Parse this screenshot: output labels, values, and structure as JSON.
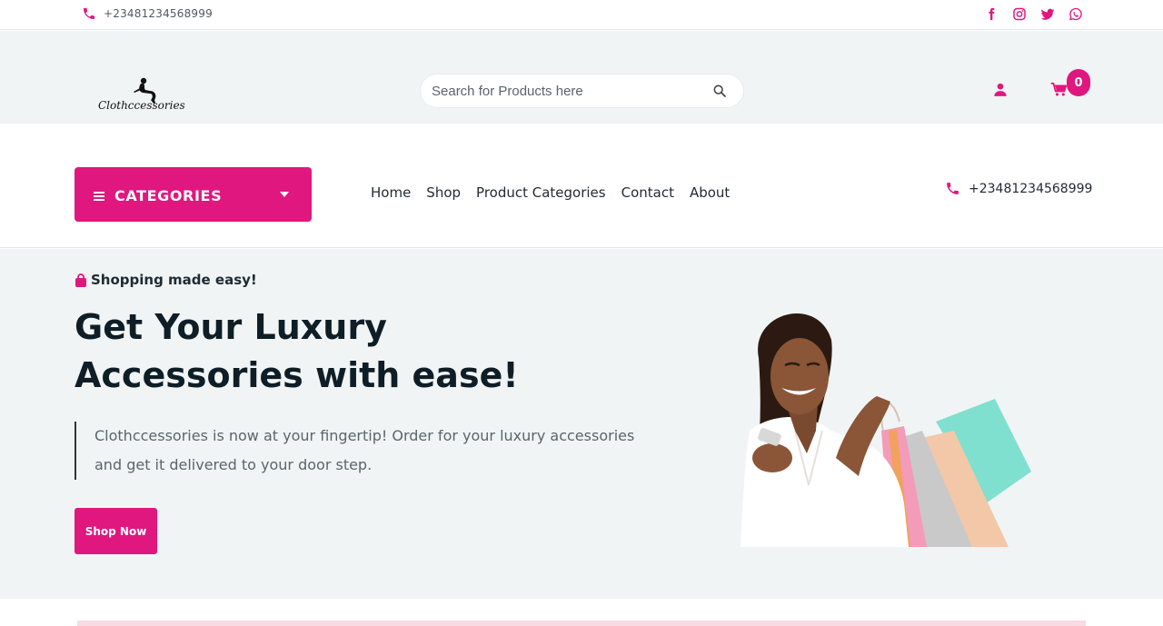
{
  "topbar": {
    "phone": "+23481234568999"
  },
  "social": [
    "facebook-icon",
    "instagram-icon",
    "twitter-icon",
    "whatsapp-icon"
  ],
  "brand": {
    "logo_text": "Clothccessories"
  },
  "search": {
    "placeholder": "Search for Products here"
  },
  "cart": {
    "count": "0"
  },
  "nav": {
    "categories_label": "CATEGORIES",
    "menu": [
      "Home",
      "Shop",
      "Product Categories",
      "Contact",
      "About"
    ],
    "phone": "+23481234568999"
  },
  "hero": {
    "tagline": "Shopping made easy!",
    "title_line1": "Get Your Luxury",
    "title_line2": "Accessories with ease!",
    "description": "Clothccessories is now at your fingertip! Order for your luxury accessories and get it delivered to your door step.",
    "cta": "Shop Now"
  },
  "colors": {
    "accent": "#e0177e",
    "background": "#f1f4f5",
    "text": "#0f1e26"
  }
}
